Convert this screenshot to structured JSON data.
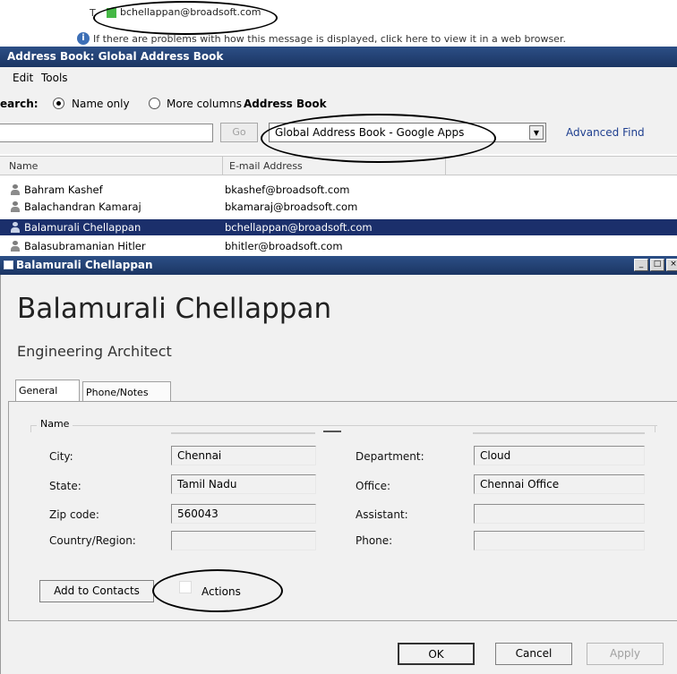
{
  "email_header": {
    "to_label": "T",
    "to_email": "bchellappan@broadsoft.com",
    "info_text": "If there are problems with how this message is displayed, click here to view it in a web browser."
  },
  "address_book": {
    "window_title": "Address Book: Global Address Book",
    "menu": [
      "Edit",
      "Tools"
    ],
    "search_label": "earch:",
    "radio_name_only": "Name only",
    "radio_more_columns": "More columns",
    "address_book_label": "Address Book",
    "search_value": "",
    "go_label": "Go",
    "address_book_selected": "Global Address Book - Google Apps",
    "advanced_find": "Advanced Find",
    "columns": [
      "Name",
      "E-mail Address"
    ],
    "rows": [
      {
        "name": "Bahram Kashef",
        "email": "bkashef@broadsoft.com"
      },
      {
        "name": "Balachandran Kamaraj",
        "email": "bkamaraj@broadsoft.com"
      },
      {
        "name": "Balamurali Chellappan",
        "email": "bchellappan@broadsoft.com"
      },
      {
        "name": "Balasubramanian Hitler",
        "email": "bhitler@broadsoft.com"
      }
    ],
    "selected_row": 2
  },
  "contact_card": {
    "window_title": "Balamurali Chellappan",
    "full_name": "Balamurali Chellappan",
    "job_title": "Engineering Architect",
    "tabs": [
      "General",
      "Phone/Notes"
    ],
    "active_tab": 0,
    "name_group": "Name",
    "fields": {
      "city_label": "City:",
      "city": "Chennai",
      "state_label": "State:",
      "state": "Tamil Nadu",
      "zip_label": "Zip code:",
      "zip": "560043",
      "country_label": "Country/Region:",
      "country": "",
      "department_label": "Department:",
      "department": "Cloud",
      "office_label": "Office:",
      "office": "Chennai Office",
      "assistant_label": "Assistant:",
      "assistant": "",
      "phone_label": "Phone:",
      "phone": ""
    },
    "add_to_contacts": "Add to Contacts",
    "actions": "Actions",
    "ok": "OK",
    "cancel": "Cancel",
    "apply": "Apply"
  },
  "colors": {
    "titlebar": "#1b3563",
    "selected_row": "#1b2f6b",
    "link": "#1f3f8f",
    "contact_status": "#45b845"
  }
}
